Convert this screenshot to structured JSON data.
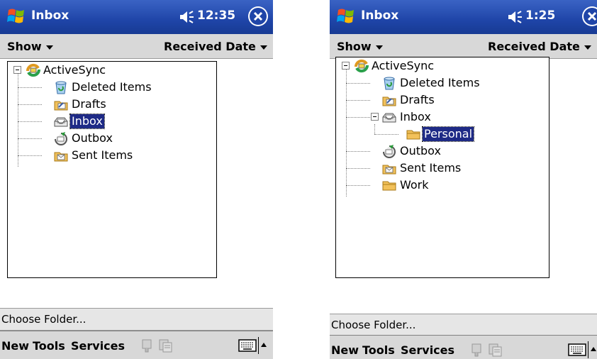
{
  "left": {
    "title": "Inbox",
    "time": "12:35",
    "show_label": "Show",
    "sort_label": "Received Date",
    "tree": {
      "root": "ActiveSync",
      "items": [
        "Deleted Items",
        "Drafts",
        "Inbox",
        "Outbox",
        "Sent Items"
      ]
    },
    "status": "Choose Folder...",
    "commands": {
      "new": "New",
      "tools": "Tools",
      "services": "Services"
    }
  },
  "right": {
    "title": "Inbox",
    "time": "1:25",
    "show_label": "Show",
    "sort_label": "Received Date",
    "tree": {
      "root": "ActiveSync",
      "items": [
        "Deleted Items",
        "Drafts",
        "Inbox",
        "Personal",
        "Outbox",
        "Sent Items",
        "Work"
      ]
    },
    "status": "Choose Folder...",
    "commands": {
      "new": "New",
      "tools": "Tools",
      "services": "Services"
    }
  },
  "selected": {
    "left": "Inbox",
    "right": "Personal"
  },
  "colors": {
    "titlebar": "#1f45a8",
    "selection": "#1e2a86",
    "menubar": "#d8d8d8"
  },
  "icons": [
    "windows-start-icon",
    "speaker-icon",
    "close-icon",
    "activesync-icon",
    "deleted-items-icon",
    "drafts-icon",
    "inbox-icon",
    "outbox-icon",
    "sent-items-icon",
    "folder-icon",
    "reply-icon",
    "properties-icon",
    "keyboard-icon",
    "sip-arrow-icon"
  ]
}
